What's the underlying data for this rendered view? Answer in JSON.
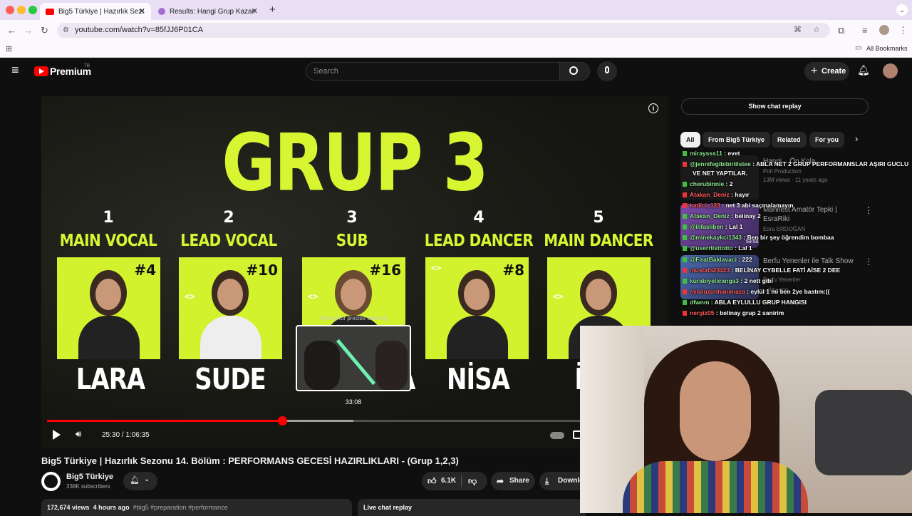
{
  "browser": {
    "tabs": [
      {
        "title": "Big5 Türkiye | Hazırlık Sezonu",
        "active": true,
        "favicon_color": "#ff0000"
      },
      {
        "title": "Results: Hangi Grup Kazanır?",
        "active": false,
        "favicon_color": "#a26bd6"
      }
    ],
    "new_tab": "+",
    "url": "youtube.com/watch?v=85fJJ6P01CA",
    "bookmarks_label": "All Bookmarks"
  },
  "youtube": {
    "logo_text": "Premium",
    "logo_sup": "TR",
    "search_placeholder": "Search",
    "create_label": "Create"
  },
  "video": {
    "headline": "GRUP 3",
    "members": [
      {
        "num": "1",
        "role": "MAIN VOCAL",
        "tag": "#4",
        "name": "LARA"
      },
      {
        "num": "2",
        "role": "LEAD VOCAL",
        "tag": "#10",
        "name": "SUDE"
      },
      {
        "num": "3",
        "role": "SUB",
        "tag": "#16",
        "name": "SELENGA"
      },
      {
        "num": "4",
        "role": "LEAD DANCER",
        "tag": "#8",
        "name": "NİSA"
      },
      {
        "num": "5",
        "role": "MAIN DANCER",
        "tag": "",
        "name": "İ"
      }
    ],
    "arrow_glyph": "<>",
    "preview_caption": "Pull up for precise seeking",
    "preview_time": "33:08",
    "timecode": "25:30 / 1:06:35",
    "progress_fraction": 0.434,
    "buffer_fraction": 0.566,
    "title": "Big5 Türkiye | Hazırlık Sezonu 14. Bölüm : PERFORMANS GECESİ HAZIRLIKLARI - (Grup 1,2,3)"
  },
  "channel": {
    "name": "Big5 Türkiye",
    "subscribers": "338K subscribers"
  },
  "actions": {
    "likes": "6.1K",
    "share": "Share",
    "download": "Downlo"
  },
  "description": {
    "views": "172,674 views",
    "age": "4 hours ago",
    "tags": "#big5 #preparation #performance"
  },
  "live_chat_label": "Live chat replay",
  "sidebar": {
    "show_chat": "Show chat replay",
    "chips": [
      "All",
      "From Big5 Türkiye",
      "Related",
      "For you"
    ],
    "recommendations": [
      {
        "title": "Hangi... Ön Kola",
        "channel": "Poll Production",
        "meta": "13M views · 11 years ago",
        "thumb": "#1a1a1a"
      },
      {
        "title": "Manifest Amatör Tepki | EsraRiki",
        "channel": "Esra ERDOĞAN",
        "meta": "59:50",
        "thumb": "#5a3a8a"
      },
      {
        "title": "Berfu Yenenler ile Talk Show",
        "channel": "Berfu Yenenler",
        "meta": "...day ago",
        "thumb": "#4a5a8a"
      }
    ]
  },
  "chat": [
    {
      "user": "miraysss11",
      "msg": "evet",
      "red": false
    },
    {
      "user": "@jennifegibibiriilstee",
      "msg": "ABLA NET 2 GRUP PERFORMANSLAR AŞIRI GUCLU",
      "red": true
    },
    {
      "user": "",
      "msg": "VE NET YAPTILAR.",
      "red": false
    },
    {
      "user": "cherubinnie",
      "msg": "2",
      "red": false
    },
    {
      "user": "Atakan_Deniz",
      "msg": "hayır",
      "red": true
    },
    {
      "user": "katilci_123",
      "msg": "net 3 abi saçmalamayın",
      "red": true
    },
    {
      "user": "Atakan_Deniz",
      "msg": "belinay 2",
      "red": false
    },
    {
      "user": "@ilifasliben",
      "msg": "Lal 1",
      "red": false
    },
    {
      "user": "@minekaykci1343",
      "msg": "Ben bir şey öğrendim bombaa",
      "red": false
    },
    {
      "user": "@userrlisttotto",
      "msg": "Lal 1",
      "red": false
    },
    {
      "user": "@FiratBaklavaci",
      "msg": "222",
      "red": false
    },
    {
      "user": "mustafa23423",
      "msg": "BELİNAY CYBELLE FATİ AİSE 2 DEE",
      "red": true
    },
    {
      "user": "kurabiyelicanga3",
      "msg": "2 nett gibi",
      "red": false
    },
    {
      "user": "eyluluzunhanimaza",
      "msg": "eylül 1 mi ben 2ye bastım:((",
      "red": true
    },
    {
      "user": "dfwnm",
      "msg": "ABLA EYLULLU GRUP HANGISI",
      "red": false
    },
    {
      "user": "nergiz05",
      "msg": "belinay grup 2 sanirim",
      "red": true
    }
  ]
}
